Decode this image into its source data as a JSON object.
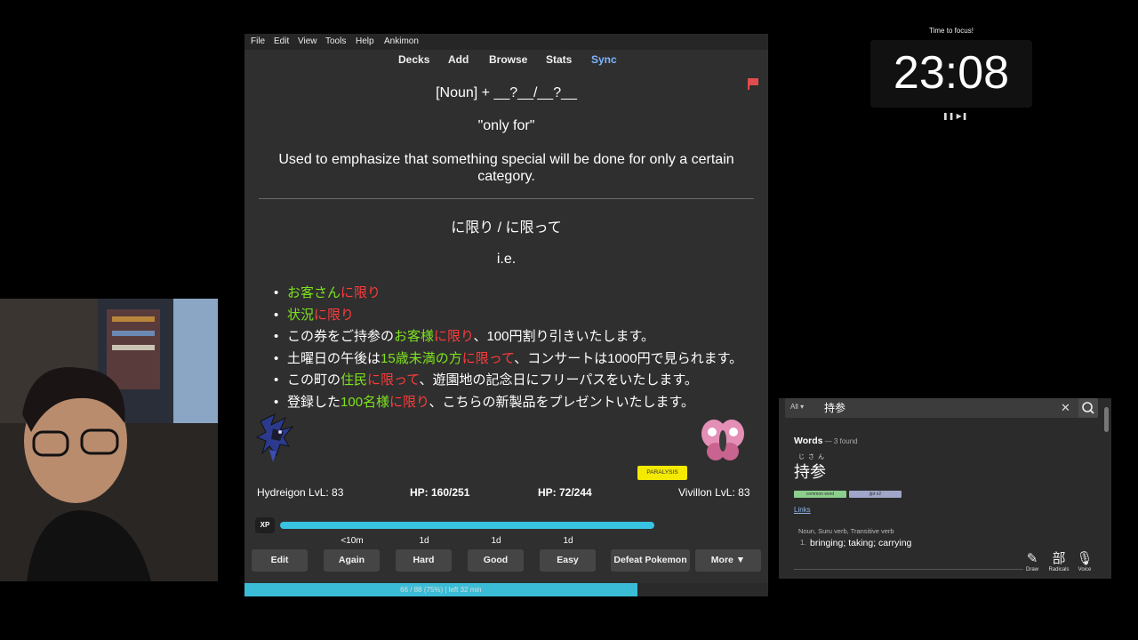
{
  "menu": [
    "File",
    "Edit",
    "View",
    "Tools",
    "Help",
    "Ankimon"
  ],
  "toolbar": {
    "decks": "Decks",
    "add": "Add",
    "browse": "Browse",
    "stats": "Stats",
    "sync": "Sync"
  },
  "card": {
    "pattern": "[Noun] + __?__/__?__",
    "meaning": "\"only for\"",
    "description": "Used to emphasize that something special will be done for only a certain category.",
    "forms": "に限り / に限って",
    "ie": "i.e.",
    "examples": [
      [
        {
          "t": "お客さん",
          "c": "g"
        },
        {
          "t": "に限り",
          "c": "r"
        }
      ],
      [
        {
          "t": "状況",
          "c": "g"
        },
        {
          "t": "に限り",
          "c": "r"
        }
      ],
      [
        {
          "t": "この券をご持参の",
          "c": "w"
        },
        {
          "t": "お客様",
          "c": "g"
        },
        {
          "t": "に限り",
          "c": "r"
        },
        {
          "t": "、100円割り引きいたします。",
          "c": "w"
        }
      ],
      [
        {
          "t": "土曜日の午後は",
          "c": "w"
        },
        {
          "t": "15歳未満の方",
          "c": "g"
        },
        {
          "t": "に限って",
          "c": "r"
        },
        {
          "t": "、コンサートは1000円で見られます。",
          "c": "w"
        }
      ],
      [
        {
          "t": "この町の",
          "c": "w"
        },
        {
          "t": "住民",
          "c": "g"
        },
        {
          "t": "に限って",
          "c": "r"
        },
        {
          "t": "、遊園地の記念日にフリーパスをいたします。",
          "c": "w"
        }
      ],
      [
        {
          "t": "登録した",
          "c": "w"
        },
        {
          "t": "100名様",
          "c": "g"
        },
        {
          "t": "に限り",
          "c": "r"
        },
        {
          "t": "、こちらの新製品をプレゼントいたします。",
          "c": "w"
        }
      ]
    ]
  },
  "battle": {
    "player": "Hydreigon LvL: 83",
    "player_hp": "HP: 160/251",
    "enemy_hp": "HP: 72/244",
    "enemy": "Vivillon LvL: 83",
    "status": "PARALYSIS",
    "xp_label": "XP",
    "xp_fraction": 0.99
  },
  "answers": {
    "due": [
      "<10m",
      "1d",
      "1d",
      "1d"
    ],
    "buttons": [
      "Edit",
      "Again",
      "Hard",
      "Good",
      "Easy",
      "Defeat Pokemon",
      "More ▼"
    ]
  },
  "progress": {
    "text": "66 / 88 (75%) | left 32 min",
    "fraction": 0.75
  },
  "timer": {
    "title": "Time to focus!",
    "time": "23:08",
    "controls": "❚❚ ▶❚"
  },
  "dictionary": {
    "scope": "All ▾",
    "query": "持参",
    "clear": "✕",
    "heading": "Words",
    "count": " — 3 found",
    "furigana": "じさん",
    "word": "持参",
    "tags": [
      "common word",
      "jlpt n2"
    ],
    "links": "Links",
    "pos": "Noun, Suru verb, Transitive verb",
    "sense_num": "1.",
    "sense": "bringing; taking; carrying",
    "tools": [
      {
        "icon": "✎",
        "label": "Draw"
      },
      {
        "icon": "部",
        "label": "Radicals"
      },
      {
        "icon": "🎙",
        "label": "Voice"
      }
    ]
  },
  "colors": {
    "accent": "#3bbcd6",
    "green": "#7ee21f",
    "red": "#ff3b3b",
    "sync": "#7eb6ff"
  }
}
